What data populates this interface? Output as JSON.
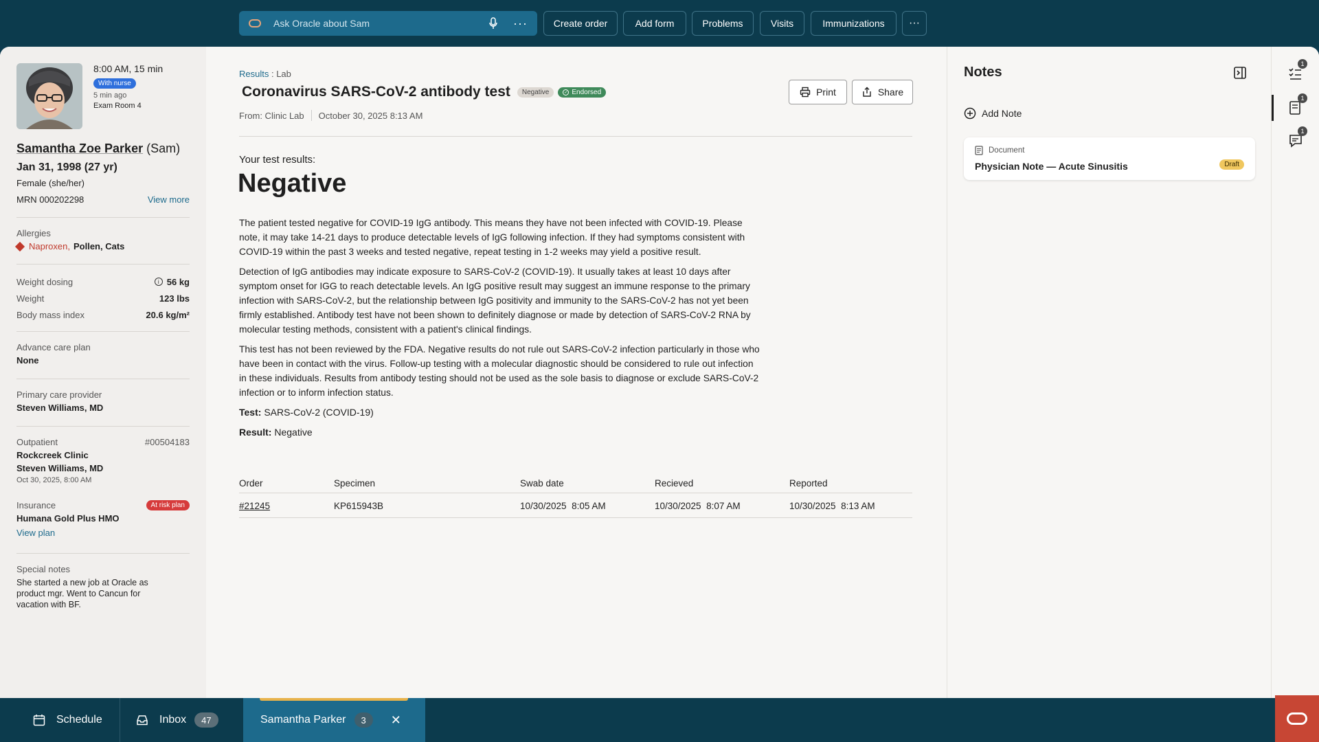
{
  "topbar": {
    "ask_placeholder": "Ask Oracle about Sam",
    "more": "···",
    "buttons": [
      "Create order",
      "Add form",
      "Problems",
      "Visits",
      "Immunizations"
    ],
    "overflow": "···"
  },
  "patient": {
    "appt_time": "8:00 AM, 15 min",
    "status_badge": "With nurse",
    "ago": "5 min ago",
    "room": "Exam Room 4",
    "name": "Samantha Zoe Parker",
    "nickname": "(Sam)",
    "dob": "Jan 31, 1998 (27 yr)",
    "gender": "Female (she/her)",
    "mrn": "MRN 000202298",
    "view_more": "View more",
    "allergies_label": "Allergies",
    "allergy_severe": "Naproxen,",
    "allergy_other": "Pollen, Cats",
    "weight_dosing_label": "Weight dosing",
    "weight_dosing_value": "56 kg",
    "weight_label": "Weight",
    "weight_value": "123 lbs",
    "bmi_label": "Body mass index",
    "bmi_value": "20.6 kg/m²",
    "acp_label": "Advance care plan",
    "acp_value": "None",
    "pcp_label": "Primary care provider",
    "pcp_value": "Steven Williams, MD",
    "encounter_type": "Outpatient",
    "encounter_id": "#00504183",
    "clinic": "Rockcreek Clinic",
    "provider": "Steven Williams, MD",
    "encounter_date": "Oct 30, 2025, 8:00 AM",
    "insurance_label": "Insurance",
    "risk_badge": "At risk plan",
    "insurance_value": "Humana Gold Plus HMO",
    "view_plan": "View plan",
    "special_label": "Special notes",
    "special_value": "She started a new job at Oracle as product mgr. Went to Cancun for vacation with BF."
  },
  "result": {
    "crumb_link": "Results",
    "crumb_rest": " : Lab",
    "title": "Coronavirus SARS-CoV-2 antibody test",
    "status_pill": "Negative",
    "endorsed_pill": "Endorsed",
    "from": "From: Clinic Lab",
    "datetime": "October 30, 2025  8:13 AM",
    "print": "Print",
    "share": "Share",
    "your_results": "Your test results:",
    "big_result": "Negative",
    "para1": "The patient tested negative for COVID-19 IgG antibody. This means they have not been infected with COVID-19. Please note, it may take 14-21 days to produce detectable levels of IgG following infection. If they had symptoms consistent with COVID-19 within the past 3 weeks and tested negative, repeat testing in 1-2 weeks may yield a positive result.",
    "para2": "Detection of IgG antibodies may indicate exposure to SARS-CoV-2 (COVID-19). It usually takes at least 10 days after symptom onset for IGG to reach detectable levels. An IgG positive result may suggest an immune response to the primary infection with SARS-CoV-2, but the relationship between IgG positivity and immunity to the SARS-CoV-2 has not yet been firmly established. Antibody test have not been shown to definitely diagnose or made by detection of SARS-CoV-2 RNA by molecular testing methods, consistent with a patient's clinical findings.",
    "para3": "This test has not been reviewed by the FDA. Negative results do not rule out SARS-CoV-2 infection particularly in those who have been in contact with the virus. Follow-up testing with a molecular diagnostic should be considered to rule out infection in these individuals. Results from antibody testing should not be used as the sole basis to diagnose or exclude SARS-CoV-2 infection or to inform infection status.",
    "test_label": "Test:",
    "test_value": "SARS-CoV-2 (COVID-19)",
    "result_label": "Result:",
    "result_value": "Negative",
    "table": {
      "headers": [
        "Order",
        "Specimen",
        "Swab date",
        "Recieved",
        "Reported"
      ],
      "row": [
        "#21245",
        "KP615943B",
        "10/30/2025  8:05 AM",
        "10/30/2025  8:07 AM",
        "10/30/2025  8:13 AM"
      ]
    }
  },
  "notes": {
    "title": "Notes",
    "add_note": "Add Note",
    "doc_type": "Document",
    "doc_name": "Physician Note — Acute Sinusitis",
    "doc_status": "Draft"
  },
  "rail": {
    "badges": [
      "1",
      "1",
      "1"
    ]
  },
  "bottombar": {
    "schedule": "Schedule",
    "inbox": "Inbox",
    "inbox_count": "47",
    "patient_tab": "Samantha Parker",
    "patient_count": "3"
  },
  "colors": {
    "brand_dark": "#0c3b4d",
    "accent": "#1d6a8c",
    "oracle_red": "#c74634",
    "endorsed": "#3f8a5a",
    "risk": "#d63b3b"
  }
}
